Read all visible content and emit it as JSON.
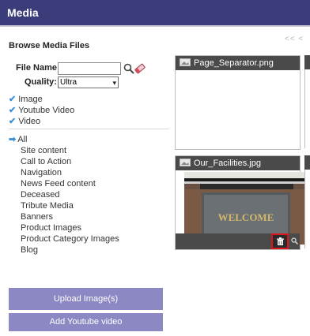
{
  "window": {
    "title": "Media"
  },
  "browse": {
    "heading": "Browse Media Files",
    "pager": "<<  <"
  },
  "filter": {
    "file_name_label": "File Name:",
    "file_name_value": "",
    "quality_label": "Quality:",
    "quality_value": "Ultra",
    "types": [
      {
        "label": "Image",
        "checked": true
      },
      {
        "label": "Youtube Video",
        "checked": true
      },
      {
        "label": "Video",
        "checked": true
      }
    ]
  },
  "categories": {
    "all": "All",
    "items": [
      "Site content",
      "Call to Action",
      "Navigation",
      "News Feed content",
      "Deceased",
      "Tribute Media",
      "Banners",
      "Product Images",
      "Product Category Images",
      "Blog"
    ]
  },
  "buttons": {
    "upload": "Upload Image(s)",
    "add_youtube": "Add Youtube video"
  },
  "media": [
    {
      "filename": "Page_Separator.png"
    },
    {
      "filename": "Our_Facilities.jpg",
      "photo_text": "WELCOME"
    }
  ],
  "colors": {
    "title_bar": "#3b3d7a",
    "button": "#8c88c4",
    "check": "#3a8fd9",
    "highlight": "#e1131a",
    "tile_header": "#4a4a4a"
  }
}
